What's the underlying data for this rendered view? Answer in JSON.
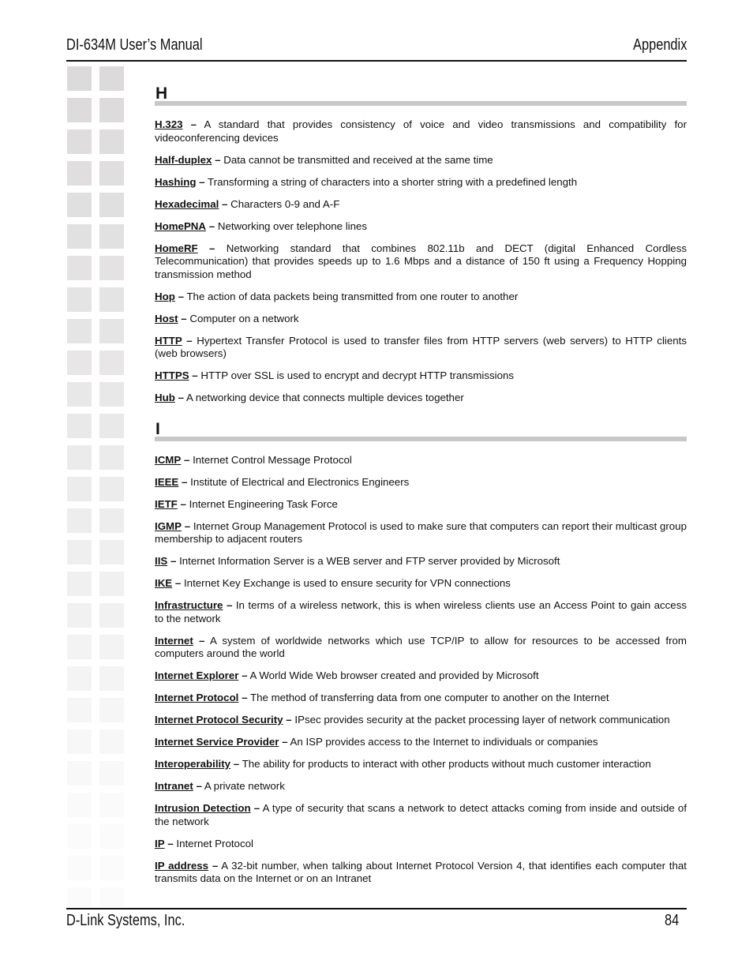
{
  "header": {
    "title": "DI-634M User’s Manual",
    "section": "Appendix"
  },
  "footer": {
    "company": "D-Link Systems, Inc.",
    "page_number": "84"
  },
  "glossary": {
    "separator": "–",
    "sections": [
      {
        "letter": "H",
        "entries": [
          {
            "term": "H.323",
            "definition": "A standard that provides consistency of voice and video transmissions and compatibility for videoconferencing devices"
          },
          {
            "term": "Half-duplex",
            "definition": "Data cannot be transmitted and received at the same time"
          },
          {
            "term": "Hashing",
            "definition": "Transforming a string of characters into a shorter string with a predefined length"
          },
          {
            "term": "Hexadecimal",
            "definition": "Characters 0-9 and A-F"
          },
          {
            "term": "HomePNA",
            "definition": "Networking over telephone lines"
          },
          {
            "term": "HomeRF",
            "definition": "Networking standard that combines 802.11b and DECT (digital Enhanced Cordless Telecommunication) that provides speeds up to 1.6 Mbps and a distance of 150 ft using a Frequency Hopping transmission method"
          },
          {
            "term": "Hop",
            "definition": "The action of data packets being transmitted from one router to another"
          },
          {
            "term": "Host",
            "definition": "Computer on a network"
          },
          {
            "term": "HTTP",
            "definition": "Hypertext Transfer Protocol is used to transfer files from HTTP servers (web servers) to HTTP clients (web browsers)"
          },
          {
            "term": "HTTPS",
            "definition": "HTTP over SSL is used to encrypt and decrypt HTTP transmissions"
          },
          {
            "term": "Hub",
            "definition": "A networking device that connects multiple devices together"
          }
        ]
      },
      {
        "letter": "I",
        "entries": [
          {
            "term": "ICMP",
            "definition": "Internet Control Message Protocol"
          },
          {
            "term": "IEEE",
            "definition": "Institute of Electrical and Electronics Engineers"
          },
          {
            "term": "IETF",
            "definition": "Internet Engineering Task Force"
          },
          {
            "term": "IGMP",
            "definition": "Internet Group Management Protocol is used to make sure that computers can report their multicast group membership to adjacent routers"
          },
          {
            "term": "IIS",
            "definition": "Internet Information Server is a WEB server and FTP server provided by Microsoft"
          },
          {
            "term": "IKE",
            "definition": "Internet Key Exchange is used to ensure security for VPN connections"
          },
          {
            "term": "Infrastructure",
            "definition": "In terms of a wireless network, this is when wireless clients use an Access Point to gain access to the network"
          },
          {
            "term": "Internet",
            "definition": "A system of worldwide networks which use TCP/IP to allow for resources to be accessed from computers around the world"
          },
          {
            "term": "Internet Explorer",
            "definition": "A World Wide Web browser created and provided by Microsoft"
          },
          {
            "term": "Internet Protocol",
            "definition": "The method of transferring data from one computer to another on the Internet"
          },
          {
            "term": "Internet Protocol Security",
            "definition": "IPsec provides security at the packet processing layer of network communication"
          },
          {
            "term": "Internet Service Provider",
            "definition": "An ISP provides access to the Internet to individuals or companies"
          },
          {
            "term": "Interoperability",
            "definition": "The ability for products to interact with other products without much customer interaction"
          },
          {
            "term": "Intranet",
            "definition": "A private network"
          },
          {
            "term": "Intrusion Detection",
            "definition": "A type of security that scans a network to detect attacks coming from inside and outside of the network"
          },
          {
            "term": "IP",
            "definition": "Internet Protocol"
          },
          {
            "term": "IP address",
            "definition": "A 32-bit number, when talking about Internet Protocol Version 4, that identifies each computer that transmits data on the Internet or on an Intranet"
          }
        ]
      }
    ]
  },
  "decoration": {
    "square_color_top": "#dcdada",
    "square_color_bottom": "#fbfbfb",
    "heading_bar_color": "#c8c8c8"
  }
}
